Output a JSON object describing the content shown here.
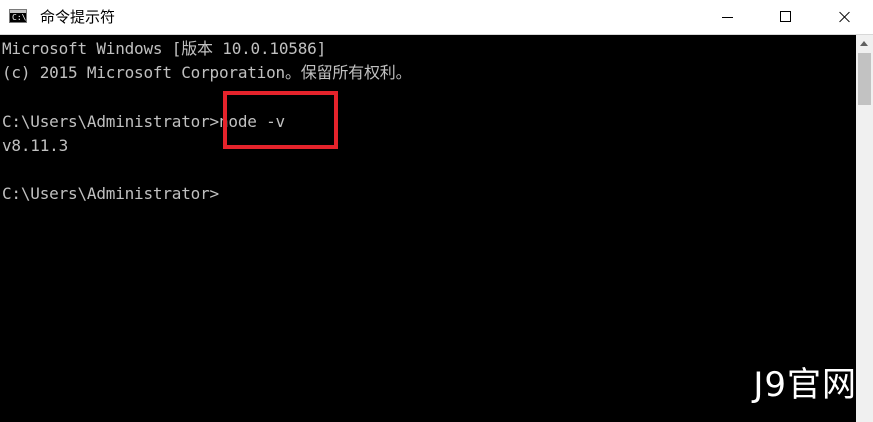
{
  "window": {
    "title": "命令提示符",
    "icon": "cmd-console-icon",
    "icon_glyph": "C:\\"
  },
  "controls": {
    "minimize": "minimize-icon",
    "maximize": "maximize-icon",
    "close": "close-icon"
  },
  "console": {
    "lines": [
      "Microsoft Windows [版本 10.0.10586]",
      "(c) 2015 Microsoft Corporation。保留所有权利。",
      "C:\\Users\\Administrator>node -v",
      "v8.11.3",
      "C:\\Users\\Administrator>"
    ],
    "text_color": "#c0c0c0",
    "background": "#000000"
  },
  "annotation": {
    "highlight_color": "#e5232b"
  },
  "watermark": {
    "text": "J9官网"
  }
}
